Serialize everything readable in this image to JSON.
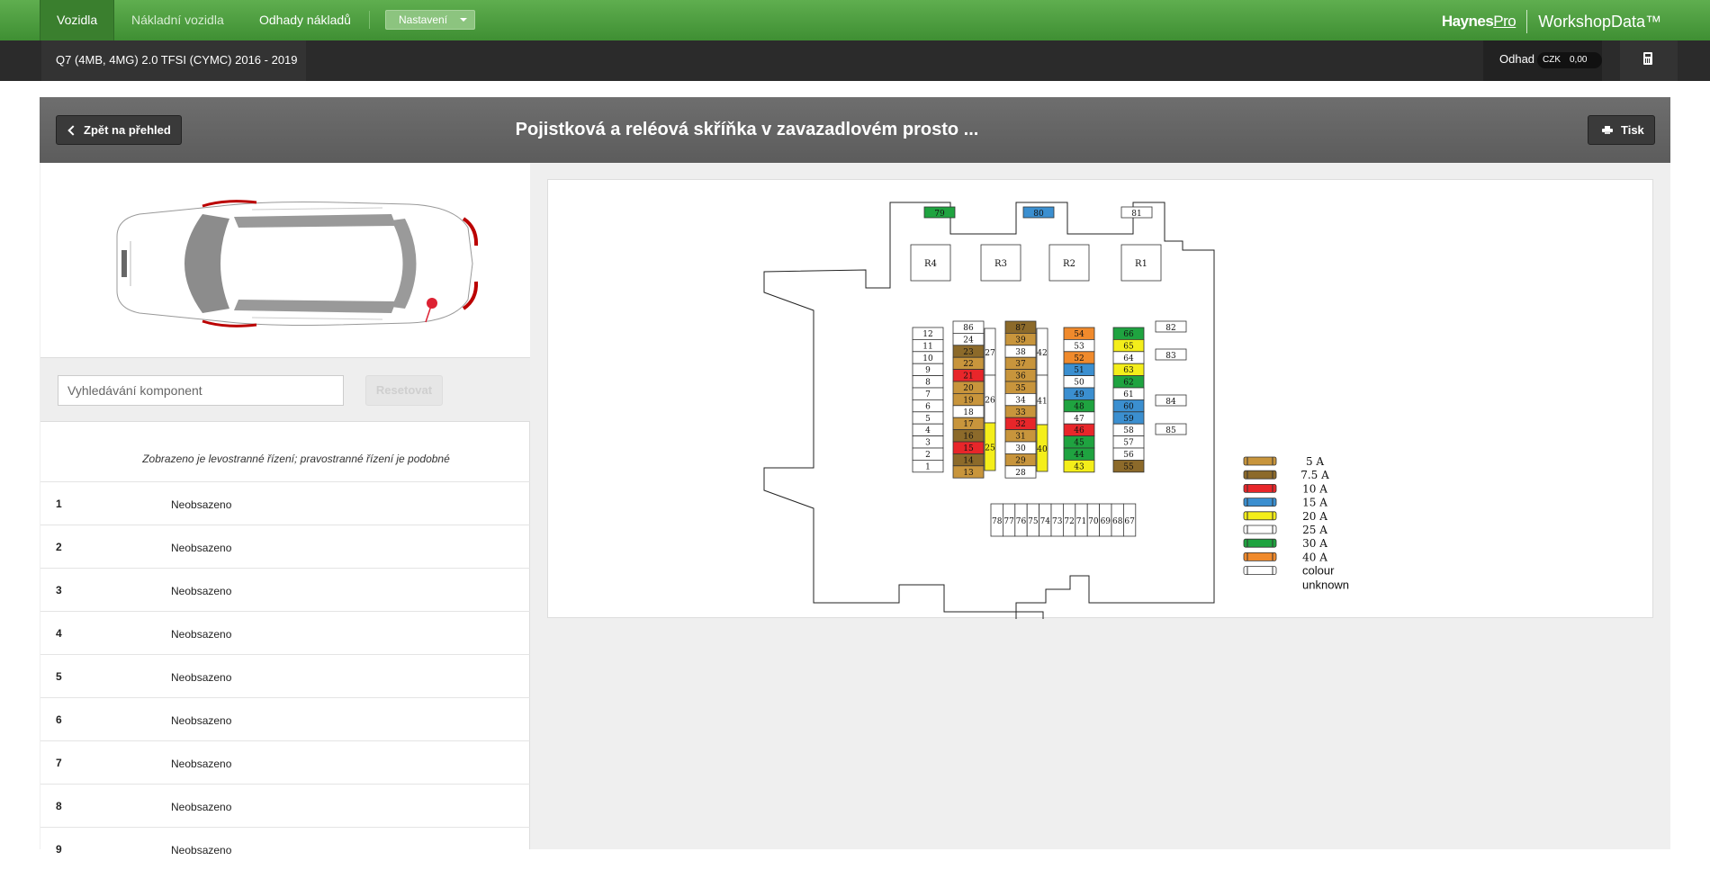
{
  "topnav": {
    "tabs": [
      {
        "label": "Vozidla",
        "active": true
      },
      {
        "label": "Nákladní vozidla",
        "active": false
      },
      {
        "label": "Odhady nákladů",
        "active": false
      }
    ],
    "settings_label": "Nastavení",
    "brand": {
      "haynes": "Haynes",
      "pro": "Pro",
      "workshop": "WorkshopData™"
    }
  },
  "vehicle": {
    "name": "Q7 (4MB, 4MG) 2.0 TFSI (CYMC) 2016 - 2019",
    "estimate_label": "Odhad",
    "currency": "CZK",
    "amount": "0,00"
  },
  "panel": {
    "back_label": "Zpět na přehled",
    "title": "Pojistková a reléová skříňka v zavazadlovém prosto ...",
    "print_label": "Tisk"
  },
  "search": {
    "placeholder": "Vyhledávání komponent",
    "reset_label": "Resetovat"
  },
  "note": "Zobrazeno je levostranné řízení; pravostranné řízení je podobné",
  "fuse_rows": [
    {
      "num": "1",
      "value": "Neobsazeno"
    },
    {
      "num": "2",
      "value": "Neobsazeno"
    },
    {
      "num": "3",
      "value": "Neobsazeno"
    },
    {
      "num": "4",
      "value": "Neobsazeno"
    },
    {
      "num": "5",
      "value": "Neobsazeno"
    },
    {
      "num": "6",
      "value": "Neobsazeno"
    },
    {
      "num": "7",
      "value": "Neobsazeno"
    },
    {
      "num": "8",
      "value": "Neobsazeno"
    },
    {
      "num": "9",
      "value": "Neobsazeno"
    }
  ],
  "colors": {
    "5A": "#c8953c",
    "7.5A": "#8c6a2a",
    "10A": "#e8262a",
    "15A": "#3b8fd0",
    "20A": "#f4ee1a",
    "25A": "#ffffff",
    "30A": "#1fa340",
    "40A": "#f08a2c",
    "unknown": "#ffffff"
  },
  "legend": [
    {
      "label": "5 A",
      "key": "5A"
    },
    {
      "label": "7.5 A",
      "key": "7.5A"
    },
    {
      "label": "10 A",
      "key": "10A"
    },
    {
      "label": "15 A",
      "key": "15A"
    },
    {
      "label": "20 A",
      "key": "20A"
    },
    {
      "label": "25 A",
      "key": "25A"
    },
    {
      "label": "30 A",
      "key": "30A"
    },
    {
      "label": "40 A",
      "key": "40A"
    },
    {
      "label": "colour",
      "key": "unknown",
      "label2": "unknown"
    }
  ],
  "relays": [
    "R4",
    "R3",
    "R2",
    "R1"
  ],
  "top_fuses": [
    {
      "n": "79",
      "c": "30A"
    },
    {
      "n": "80",
      "c": "15A"
    },
    {
      "n": "81",
      "c": "unknown"
    }
  ],
  "side_fuses": [
    "82",
    "83",
    "84",
    "85"
  ],
  "fuse_columns": [
    {
      "fuses": [
        {
          "n": "12",
          "c": "unknown"
        },
        {
          "n": "11",
          "c": "unknown"
        },
        {
          "n": "10",
          "c": "unknown"
        },
        {
          "n": "9",
          "c": "unknown"
        },
        {
          "n": "8",
          "c": "unknown"
        },
        {
          "n": "7",
          "c": "unknown"
        },
        {
          "n": "6",
          "c": "unknown"
        },
        {
          "n": "5",
          "c": "unknown"
        },
        {
          "n": "4",
          "c": "unknown"
        },
        {
          "n": "3",
          "c": "unknown"
        },
        {
          "n": "2",
          "c": "unknown"
        },
        {
          "n": "1",
          "c": "unknown"
        }
      ]
    },
    {
      "fuses": [
        {
          "n": "86",
          "c": "unknown"
        },
        {
          "n": "24",
          "c": "unknown"
        },
        {
          "n": "23",
          "c": "7.5A"
        },
        {
          "n": "22",
          "c": "5A"
        },
        {
          "n": "21",
          "c": "10A"
        },
        {
          "n": "20",
          "c": "5A"
        },
        {
          "n": "19",
          "c": "5A"
        },
        {
          "n": "18",
          "c": "unknown"
        },
        {
          "n": "17",
          "c": "5A"
        },
        {
          "n": "16",
          "c": "7.5A"
        },
        {
          "n": "15",
          "c": "10A"
        },
        {
          "n": "14",
          "c": "7.5A"
        },
        {
          "n": "13",
          "c": "5A"
        }
      ]
    },
    {
      "fuses": [
        {
          "n": "87",
          "c": "7.5A"
        },
        {
          "n": "39",
          "c": "5A"
        },
        {
          "n": "38",
          "c": "unknown"
        },
        {
          "n": "37",
          "c": "5A"
        },
        {
          "n": "36",
          "c": "5A"
        },
        {
          "n": "35",
          "c": "5A"
        },
        {
          "n": "34",
          "c": "unknown"
        },
        {
          "n": "33",
          "c": "5A"
        },
        {
          "n": "32",
          "c": "10A"
        },
        {
          "n": "31",
          "c": "5A"
        },
        {
          "n": "30",
          "c": "unknown"
        },
        {
          "n": "29",
          "c": "5A"
        },
        {
          "n": "28",
          "c": "unknown"
        }
      ]
    },
    {
      "fuses": [
        {
          "n": "54",
          "c": "40A"
        },
        {
          "n": "53",
          "c": "unknown"
        },
        {
          "n": "52",
          "c": "40A"
        },
        {
          "n": "51",
          "c": "15A"
        },
        {
          "n": "50",
          "c": "unknown"
        },
        {
          "n": "49",
          "c": "15A"
        },
        {
          "n": "48",
          "c": "30A"
        },
        {
          "n": "47",
          "c": "unknown"
        },
        {
          "n": "46",
          "c": "10A"
        },
        {
          "n": "45",
          "c": "30A"
        },
        {
          "n": "44",
          "c": "30A"
        },
        {
          "n": "43",
          "c": "20A"
        }
      ]
    },
    {
      "fuses": [
        {
          "n": "66",
          "c": "30A"
        },
        {
          "n": "65",
          "c": "20A"
        },
        {
          "n": "64",
          "c": "unknown"
        },
        {
          "n": "63",
          "c": "20A"
        },
        {
          "n": "62",
          "c": "30A"
        },
        {
          "n": "61",
          "c": "unknown"
        },
        {
          "n": "60",
          "c": "15A"
        },
        {
          "n": "59",
          "c": "15A"
        },
        {
          "n": "58",
          "c": "unknown"
        },
        {
          "n": "57",
          "c": "unknown"
        },
        {
          "n": "56",
          "c": "unknown"
        },
        {
          "n": "55",
          "c": "7.5A"
        }
      ]
    }
  ],
  "tall_fuses": [
    {
      "n": "27",
      "c": "unknown"
    },
    {
      "n": "26",
      "c": "unknown"
    },
    {
      "n": "25",
      "c": "20A"
    },
    {
      "n": "42",
      "c": "unknown"
    },
    {
      "n": "41",
      "c": "unknown"
    },
    {
      "n": "40",
      "c": "20A"
    }
  ],
  "bottom_fuses": [
    "78",
    "77",
    "76",
    "75",
    "74",
    "73",
    "72",
    "71",
    "70",
    "69",
    "68",
    "67"
  ]
}
